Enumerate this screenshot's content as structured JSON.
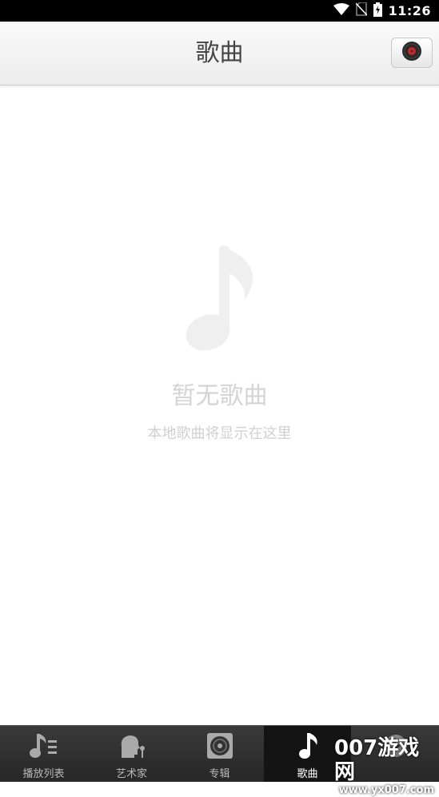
{
  "status_bar": {
    "time": "11:26",
    "icons": [
      "wifi-icon",
      "no-sim-icon",
      "battery-charging-icon"
    ]
  },
  "header": {
    "title": "歌曲",
    "record_button_icon": "record-disc-icon"
  },
  "empty_state": {
    "icon": "music-note-icon",
    "title": "暂无歌曲",
    "subtitle": "本地歌曲将显示在这里"
  },
  "bottom_nav": {
    "tabs": [
      {
        "label": "播放列表",
        "icon": "playlist-icon",
        "active": false
      },
      {
        "label": "艺术家",
        "icon": "artist-icon",
        "active": false
      },
      {
        "label": "专辑",
        "icon": "album-icon",
        "active": false
      },
      {
        "label": "歌曲",
        "icon": "music-note-icon",
        "active": true
      },
      {
        "label": "",
        "icon": "folder-icon",
        "active": false
      }
    ]
  },
  "watermark": {
    "brand": "007游戏网",
    "url": "www.yx007.com"
  },
  "colors": {
    "status_bar": "#000000",
    "header_bg": "#f2f2f2",
    "title_text": "#444444",
    "empty_text": "#d4d4d4",
    "nav_bg": "#2f2f2f",
    "nav_active_bg": "#141414",
    "record_accent": "#c0272d"
  }
}
